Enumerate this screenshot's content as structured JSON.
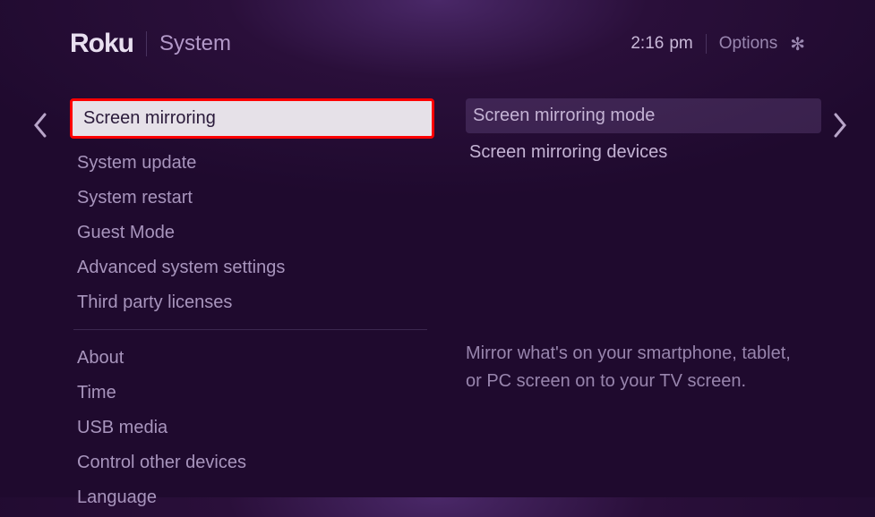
{
  "header": {
    "logo": "Roku",
    "screen_title": "System",
    "time": "2:16",
    "ampm": "pm",
    "options_label": "Options"
  },
  "left_menu": {
    "selected": "Screen mirroring",
    "group1": [
      "System update",
      "System restart",
      "Guest Mode",
      "Advanced system settings",
      "Third party licenses"
    ],
    "group2": [
      "About",
      "Time",
      "USB media",
      "Control other devices",
      "Language"
    ]
  },
  "right_menu": {
    "items": [
      "Screen mirroring mode",
      "Screen mirroring devices"
    ]
  },
  "description": "Mirror what's on your smartphone, tablet, or PC screen on to your TV screen."
}
